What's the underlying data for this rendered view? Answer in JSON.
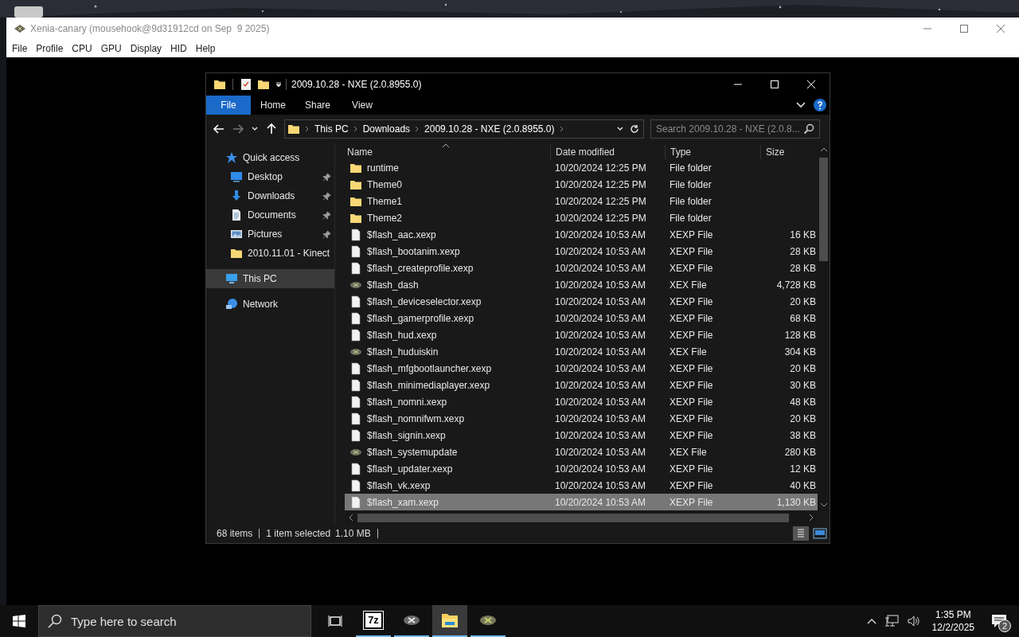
{
  "app_window": {
    "title": "Xenia-canary (mousehook@9d31912cd on Sep  9 2025)",
    "menu": [
      "File",
      "Profile",
      "CPU",
      "GPU",
      "Display",
      "HID",
      "Help"
    ]
  },
  "explorer": {
    "title": "2009.10.28 - NXE (2.0.8955.0)",
    "ribbon_tabs": [
      {
        "label": "File",
        "selected": true
      },
      {
        "label": "Home",
        "selected": false
      },
      {
        "label": "Share",
        "selected": false
      },
      {
        "label": "View",
        "selected": false
      }
    ],
    "address": [
      "This PC",
      "Downloads",
      "2009.10.28 - NXE (2.0.8955.0)"
    ],
    "search": {
      "placeholder": "Search 2009.10.28 - NXE (2.0.8..."
    },
    "nav": [
      {
        "label": "Quick access",
        "kind": "star",
        "selected": false,
        "children": [
          {
            "label": "Desktop",
            "kind": "desktop",
            "pinned": true,
            "selected": false
          },
          {
            "label": "Downloads",
            "kind": "download",
            "pinned": true,
            "selected": false
          },
          {
            "label": "Documents",
            "kind": "document",
            "pinned": true,
            "selected": false
          },
          {
            "label": "Pictures",
            "kind": "pictures",
            "pinned": true,
            "selected": false
          },
          {
            "label": "2010.11.01 - Kinect",
            "kind": "folder",
            "pinned": false,
            "selected": false
          }
        ]
      },
      {
        "label": "This PC",
        "kind": "pc",
        "selected": true
      },
      {
        "label": "Network",
        "kind": "network",
        "selected": false
      }
    ],
    "columns": [
      "Name",
      "Date modified",
      "Type",
      "Size"
    ],
    "rows": [
      {
        "kind": "folder",
        "name": "runtime",
        "date": "10/20/2024 12:25 PM",
        "type": "File folder",
        "selected": false
      },
      {
        "kind": "folder",
        "name": "Theme0",
        "date": "10/20/2024 12:25 PM",
        "type": "File folder",
        "selected": false
      },
      {
        "kind": "folder",
        "name": "Theme1",
        "date": "10/20/2024 12:25 PM",
        "type": "File folder",
        "selected": false
      },
      {
        "kind": "folder",
        "name": "Theme2",
        "date": "10/20/2024 12:25 PM",
        "type": "File folder",
        "selected": false
      },
      {
        "kind": "file",
        "name": "$flash_aac.xexp",
        "date": "10/20/2024 10:53 AM",
        "type": "XEXP File",
        "size": "16 KB",
        "selected": false
      },
      {
        "kind": "file",
        "name": "$flash_bootanim.xexp",
        "date": "10/20/2024 10:53 AM",
        "type": "XEXP File",
        "size": "28 KB",
        "selected": false
      },
      {
        "kind": "file",
        "name": "$flash_createprofile.xexp",
        "date": "10/20/2024 10:53 AM",
        "type": "XEXP File",
        "size": "28 KB",
        "selected": false
      },
      {
        "kind": "xex",
        "name": "$flash_dash",
        "date": "10/20/2024 10:53 AM",
        "type": "XEX File",
        "size": "4,728 KB",
        "selected": false
      },
      {
        "kind": "file",
        "name": "$flash_deviceselector.xexp",
        "date": "10/20/2024 10:53 AM",
        "type": "XEXP File",
        "size": "20 KB",
        "selected": false
      },
      {
        "kind": "file",
        "name": "$flash_gamerprofile.xexp",
        "date": "10/20/2024 10:53 AM",
        "type": "XEXP File",
        "size": "68 KB",
        "selected": false
      },
      {
        "kind": "file",
        "name": "$flash_hud.xexp",
        "date": "10/20/2024 10:53 AM",
        "type": "XEXP File",
        "size": "128 KB",
        "selected": false
      },
      {
        "kind": "xex",
        "name": "$flash_huduiskin",
        "date": "10/20/2024 10:53 AM",
        "type": "XEX File",
        "size": "304 KB",
        "selected": false
      },
      {
        "kind": "file",
        "name": "$flash_mfgbootlauncher.xexp",
        "date": "10/20/2024 10:53 AM",
        "type": "XEXP File",
        "size": "20 KB",
        "selected": false
      },
      {
        "kind": "file",
        "name": "$flash_minimediaplayer.xexp",
        "date": "10/20/2024 10:53 AM",
        "type": "XEXP File",
        "size": "30 KB",
        "selected": false
      },
      {
        "kind": "file",
        "name": "$flash_nomni.xexp",
        "date": "10/20/2024 10:53 AM",
        "type": "XEXP File",
        "size": "48 KB",
        "selected": false
      },
      {
        "kind": "file",
        "name": "$flash_nomnifwm.xexp",
        "date": "10/20/2024 10:53 AM",
        "type": "XEXP File",
        "size": "20 KB",
        "selected": false
      },
      {
        "kind": "file",
        "name": "$flash_signin.xexp",
        "date": "10/20/2024 10:53 AM",
        "type": "XEXP File",
        "size": "38 KB",
        "selected": false
      },
      {
        "kind": "xex",
        "name": "$flash_systemupdate",
        "date": "10/20/2024 10:53 AM",
        "type": "XEX File",
        "size": "280 KB",
        "selected": false
      },
      {
        "kind": "file",
        "name": "$flash_updater.xexp",
        "date": "10/20/2024 10:53 AM",
        "type": "XEXP File",
        "size": "12 KB",
        "selected": false
      },
      {
        "kind": "file",
        "name": "$flash_vk.xexp",
        "date": "10/20/2024 10:53 AM",
        "type": "XEXP File",
        "size": "40 KB",
        "selected": false
      },
      {
        "kind": "file",
        "name": "$flash_xam.xexp",
        "date": "10/20/2024 10:53 AM",
        "type": "XEXP File",
        "size": "1,130 KB",
        "selected": true
      }
    ],
    "status": [
      "68 items",
      "1 item selected",
      "1.10 MB"
    ]
  },
  "taskbar": {
    "search": {
      "placeholder": "Type here to search"
    },
    "apps": [
      {
        "kind": "taskview",
        "selected": false
      },
      {
        "kind": "sevenzip",
        "label": "7z",
        "selected": false
      },
      {
        "kind": "xenia",
        "selected": false
      },
      {
        "kind": "explorer",
        "selected": true
      },
      {
        "kind": "xenia_green",
        "selected": false
      }
    ],
    "time": "1:35 PM",
    "date": "12/2/2025",
    "notifications": "2"
  }
}
